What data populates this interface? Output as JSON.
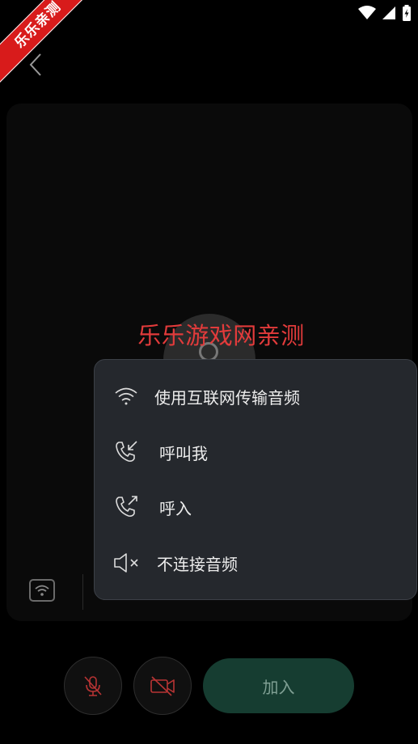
{
  "ribbon": {
    "text": "乐乐亲测"
  },
  "watermark": {
    "text": "乐乐游戏网亲测"
  },
  "audio_menu": {
    "items": [
      {
        "label": "使用互联网传输音频",
        "icon": "wifi-icon"
      },
      {
        "label": "呼叫我",
        "icon": "phone-incoming-icon"
      },
      {
        "label": "呼入",
        "icon": "phone-outgoing-icon"
      },
      {
        "label": "不连接音频",
        "icon": "speaker-mute-icon"
      }
    ]
  },
  "footer": {
    "join_label": "加入"
  },
  "colors": {
    "accent_red": "#d81b1b",
    "menu_bg": "#25282d",
    "join_bg": "#163d31",
    "muted_red": "#b83434"
  }
}
